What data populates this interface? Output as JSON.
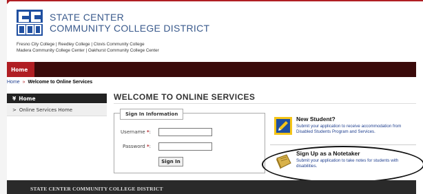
{
  "header": {
    "logo_letters": "SCCCD",
    "brand_line1": "STATE CENTER",
    "brand_line2": "COMMUNITY COLLEGE DISTRICT",
    "colleges_line1": "Fresno City College | Reedley College | Clovis Community College",
    "colleges_line2": "Madera Community College Center | Oakhurst Community College Center"
  },
  "nav": {
    "home_label": "Home"
  },
  "breadcrumb": {
    "home": "Home",
    "separator": "»",
    "current": "Welcome to Online Services"
  },
  "sidebar": {
    "header": "Home",
    "header_icon": "double-chevron-down",
    "items": [
      {
        "label": "Online Services Home",
        "icon": "chevron-right"
      }
    ]
  },
  "main": {
    "title": "WELCOME TO ONLINE SERVICES",
    "signin": {
      "legend": "Sign In Information",
      "username_label": "Username",
      "password_label": "Password",
      "required_marker": "*",
      "colon": ":",
      "username_value": "",
      "password_value": "",
      "button_label": "Sign In"
    },
    "panels": [
      {
        "icon": "new-student-icon",
        "title": "New Student?",
        "desc_line1": "Submit your application to receive accommodation from",
        "desc_line2": "Disabled Students Program and Services."
      },
      {
        "icon": "notetaker-notebook-icon",
        "title": "Sign Up as a Notetaker",
        "desc_line1": "Submit your application to take notes for students with",
        "desc_line2": "disabilities."
      }
    ]
  },
  "footer": {
    "text": "STATE CENTER COMMUNITY COLLEGE DISTRICT"
  },
  "colors": {
    "brand_red": "#b01e23",
    "brand_blue": "#1f4fa0",
    "nav_dark": "#3a0a0a",
    "link_blue": "#1f3f8f",
    "footer_bg": "#2a2a2a"
  }
}
